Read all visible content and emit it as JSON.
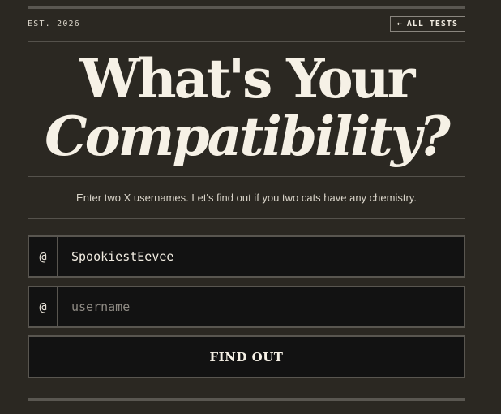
{
  "header": {
    "est_label": "EST. 2026",
    "all_tests_arrow": "←",
    "all_tests_label": "ALL TESTS"
  },
  "title": {
    "line1": "What's Your",
    "line2": "Compatibility?"
  },
  "subtitle": "Enter two X usernames. Let's find out if you two cats have any chemistry.",
  "form": {
    "at_symbol": "@",
    "user1": {
      "value": "SpookiestEevee",
      "placeholder": "username"
    },
    "user2": {
      "value": "",
      "placeholder": "username"
    },
    "submit_label": "FIND OUT"
  }
}
